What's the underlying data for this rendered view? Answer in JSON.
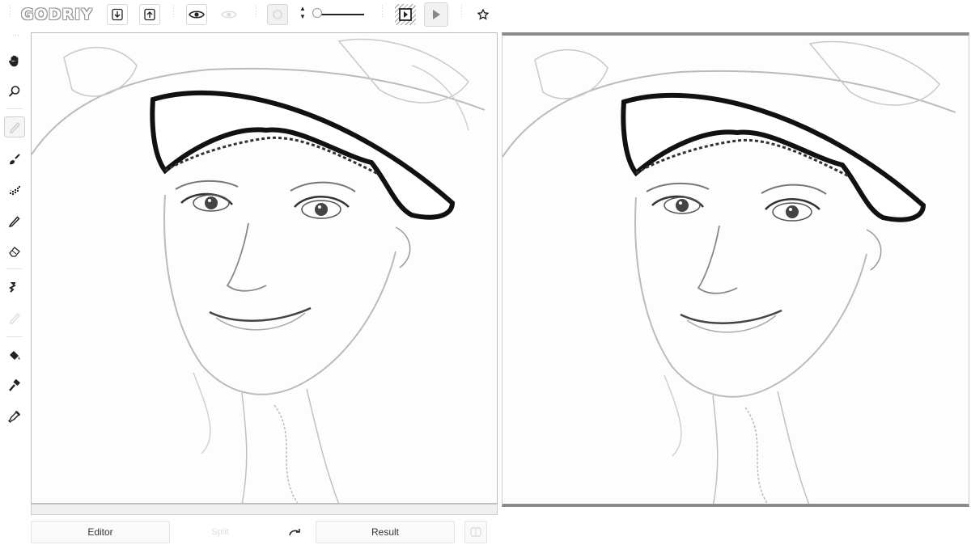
{
  "app": {
    "logo_text": "GODRIY"
  },
  "toolbar": {
    "download_icon": "download-arrow-icon",
    "upload_icon": "upload-arrow-icon",
    "eye_icon": "eye-icon",
    "eye_faded_icon": "eye-faded-icon",
    "brush_size_icon": "brush-size-icon",
    "size_slider_value": 0.0,
    "play_frame_icon": "play-frame-icon",
    "play_icon": "play-icon",
    "star_icon": "star-icon"
  },
  "tools": [
    {
      "name": "hand-icon",
      "selected": false
    },
    {
      "name": "zoom-icon",
      "selected": false
    },
    {
      "name": "pencil-faded-icon",
      "selected": true
    },
    {
      "name": "paint-brush-icon",
      "selected": false
    },
    {
      "name": "spray-icon",
      "selected": false
    },
    {
      "name": "pencil-icon",
      "selected": false
    },
    {
      "name": "eraser-icon",
      "selected": false
    },
    {
      "name": "squiggle-icon",
      "selected": false
    },
    {
      "name": "smudge-faded-icon",
      "selected": false
    },
    {
      "name": "fill-bucket-icon",
      "selected": false
    },
    {
      "name": "hammer-icon",
      "selected": false
    },
    {
      "name": "eyedropper-icon",
      "selected": false
    }
  ],
  "bottom": {
    "editor_label": "Editor",
    "split_label": "Split",
    "result_label": "Result"
  },
  "colors": {
    "accent": "#222222",
    "border": "#cccccc",
    "sketch": "#555555"
  }
}
